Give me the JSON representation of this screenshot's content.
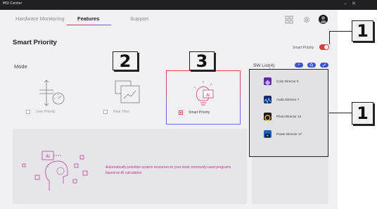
{
  "window": {
    "title": "MSI Center",
    "minimize": "–",
    "close": "✕"
  },
  "nav": {
    "tabs": [
      {
        "label": "Hardware Monitoring"
      },
      {
        "label": "Features"
      },
      {
        "label": "Support"
      }
    ],
    "icons": [
      "grid-icon",
      "gear-icon",
      "avatar-icon"
    ]
  },
  "section": {
    "title": "Smart Priority"
  },
  "toggle": {
    "label": "Smart Priority",
    "state": "on",
    "color": "#e13a3a"
  },
  "mode": {
    "label": "Mode",
    "options": [
      {
        "name": "User Priority",
        "checked": false,
        "icon": "sliders-gauge-icon"
      },
      {
        "name": "Real-Time",
        "checked": false,
        "icon": "windows-chart-icon"
      },
      {
        "name": "Smart Priority",
        "checked": true,
        "icon": "ai-bulb-icon"
      }
    ]
  },
  "callouts": [
    "2",
    "3",
    "1",
    "1"
  ],
  "sw_list": {
    "title": "SW List(4)",
    "buttons": [
      "+",
      "🔍",
      "✎"
    ],
    "items": [
      {
        "name": "Color Director 5",
        "icon": "color-director-icon",
        "color": "#5a2e9e"
      },
      {
        "name": "Audio Director 7",
        "icon": "audio-director-icon",
        "color": "#1c2a6e"
      },
      {
        "name": "Photo Director 13",
        "icon": "photo-director-icon",
        "color": "#e8b400"
      },
      {
        "name": "Power Director 17",
        "icon": "power-director-icon",
        "color": "#1d5fb8"
      }
    ]
  },
  "ai_panel": {
    "text": "Automatically prioritize system resources to your most commonly used programs based on AI calculation"
  },
  "colors": {
    "accent": "#e13a3a",
    "brand_blue": "#3a55d6",
    "ai_text": "#b9308a"
  }
}
